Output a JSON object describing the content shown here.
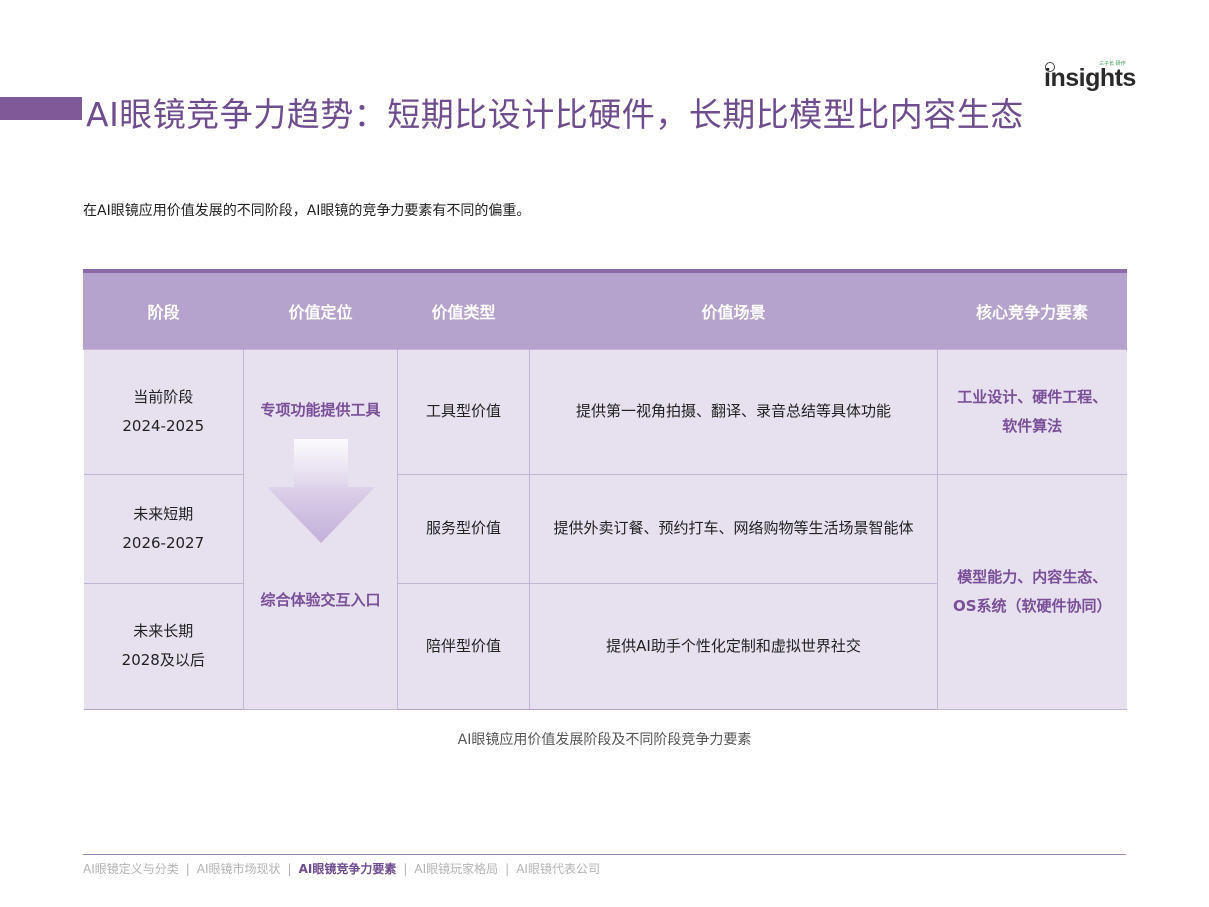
{
  "title": "AI眼镜竞争力趋势：短期比设计比硬件，长期比模型比内容生态",
  "logo": {
    "text": "insights",
    "small": "三子长 研作"
  },
  "intro": "在AI眼镜应用价值发展的不同阶段，AI眼镜的竞争力要素有不同的偏重。",
  "table": {
    "headers": [
      "阶段",
      "价值定位",
      "价值类型",
      "价值场景",
      "核心竞争力要素"
    ],
    "stages": [
      {
        "name": "当前阶段",
        "years": "2024-2025"
      },
      {
        "name": "未来短期",
        "years": "2026-2027"
      },
      {
        "name": "未来长期",
        "years": "2028及以后"
      }
    ],
    "positioning": {
      "top": "专项功能提供工具",
      "bottom": "综合体验交互入口"
    },
    "types": [
      "工具型价值",
      "服务型价值",
      "陪伴型价值"
    ],
    "scenes": [
      "提供第一视角拍摄、翻译、录音总结等具体功能",
      "提供外卖订餐、预约打车、网络购物等生活场景智能体",
      "提供AI助手个性化定制和虚拟世界社交"
    ],
    "core": [
      {
        "line1": "工业设计、硬件工程、",
        "line2": "软件算法"
      },
      {
        "line1": "模型能力、内容生态、",
        "line2": "OS系统（软硬件协同）"
      }
    ]
  },
  "caption": "AI眼镜应用价值发展阶段及不同阶段竞争力要素",
  "footer": {
    "nav": [
      "AI眼镜定义与分类",
      "AI眼镜市场现状",
      "AI眼镜竞争力要素",
      "AI眼镜玩家格局",
      "AI眼镜代表公司"
    ],
    "separator": "|",
    "active_index": 2
  },
  "colors": {
    "accent": "#7f5a98",
    "header_bg": "#b5a3cd",
    "cell_bg": "#e7e1ef",
    "emphasis": "#7a4f98"
  }
}
